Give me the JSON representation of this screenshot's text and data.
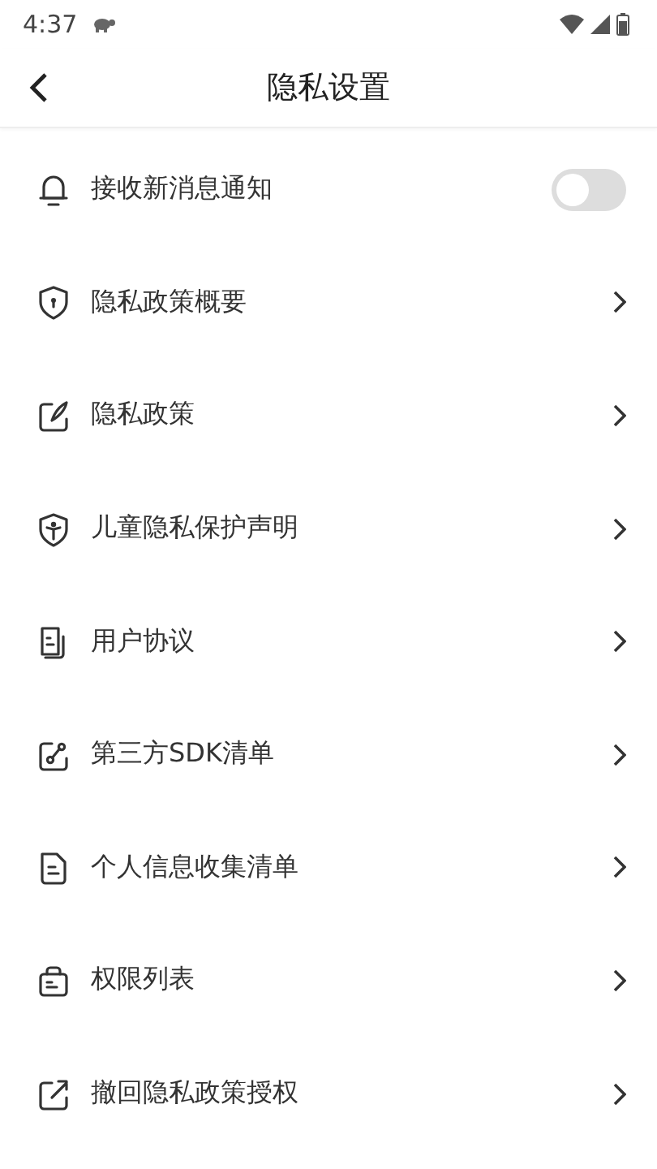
{
  "status_bar": {
    "time": "4:37"
  },
  "header": {
    "title": "隐私设置"
  },
  "items": [
    {
      "kind": "toggle",
      "label": "接收新消息通知",
      "on": false
    },
    {
      "kind": "link",
      "label": "隐私政策概要"
    },
    {
      "kind": "link",
      "label": "隐私政策"
    },
    {
      "kind": "link",
      "label": "儿童隐私保护声明"
    },
    {
      "kind": "link",
      "label": "用户协议"
    },
    {
      "kind": "link",
      "label": "第三方SDK清单"
    },
    {
      "kind": "link",
      "label": "个人信息收集清单"
    },
    {
      "kind": "link",
      "label": "权限列表"
    },
    {
      "kind": "link",
      "label": "撤回隐私政策授权"
    }
  ]
}
